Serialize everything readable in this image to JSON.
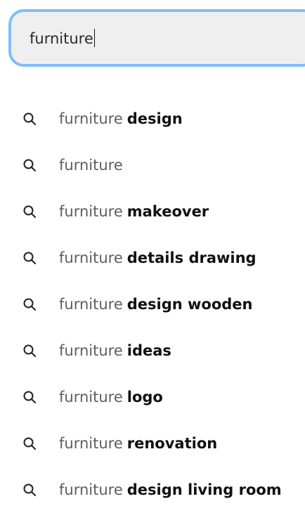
{
  "search": {
    "value": "furniture"
  },
  "suggestions": [
    {
      "prefix": "furniture",
      "completion": "design",
      "icon": "search-icon"
    },
    {
      "prefix": "furniture",
      "completion": "",
      "icon": "search-icon"
    },
    {
      "prefix": "furniture",
      "completion": "makeover",
      "icon": "search-icon"
    },
    {
      "prefix": "furniture",
      "completion": "details drawing",
      "icon": "search-icon"
    },
    {
      "prefix": "furniture",
      "completion": "design wooden",
      "icon": "search-icon"
    },
    {
      "prefix": "furniture",
      "completion": "ideas",
      "icon": "search-icon"
    },
    {
      "prefix": "furniture",
      "completion": "logo",
      "icon": "search-icon"
    },
    {
      "prefix": "furniture",
      "completion": "renovation",
      "icon": "search-icon"
    },
    {
      "prefix": "furniture",
      "completion": "design living room",
      "icon": "search-icon"
    }
  ],
  "colors": {
    "focus_border": "#7fbff6",
    "input_background": "#efefef",
    "prefix_text": "#5e5e5e",
    "completion_text": "#111111"
  }
}
